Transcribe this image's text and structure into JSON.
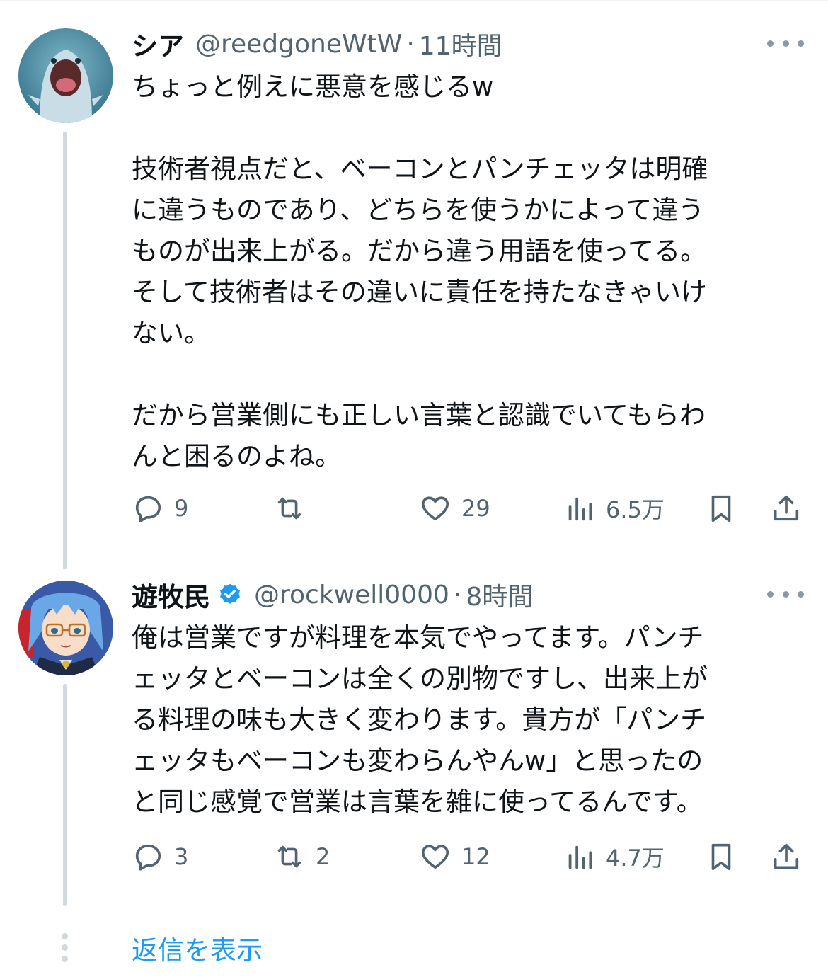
{
  "tweets": [
    {
      "name": "シア",
      "handle": "@reedgoneWtW",
      "separator": "·",
      "time": "11時間",
      "verified": false,
      "avatar_icon": "avatar-quagsire",
      "body_lines": [
        "ちょっと例えに悪意を感じるw",
        "",
        "技術者視点だと、ベーコンとパンチェッタは明確",
        "に違うものであり、どちらを使うかによって違う",
        "ものが出来上がる。だから違う用語を使ってる。",
        "そして技術者はその違いに責任を持たなきゃいけ",
        "ない。",
        "",
        "だから営業側にも正しい言葉と認識でいてもらわ",
        "んと困るのよね。"
      ],
      "stats": {
        "replies": "9",
        "retweets": "",
        "likes": "29",
        "views": "6.5万"
      }
    },
    {
      "name": "遊牧民",
      "handle": "@rockwell0000",
      "separator": "·",
      "time": "8時間",
      "verified": true,
      "avatar_icon": "avatar-anime-girl",
      "body_lines": [
        "俺は営業ですが料理を本気でやってます。パンチ",
        "ェッタとベーコンは全くの別物ですし、出来上が",
        "る料理の味も大きく変わります。貴方が「パンチ",
        "ェッタもベーコンも変わらんやんw」と思ったの",
        "と同じ感覚で営業は言葉を雑に使ってるんです。"
      ],
      "stats": {
        "replies": "3",
        "retweets": "2",
        "likes": "12",
        "views": "4.7万"
      }
    }
  ],
  "show_replies_label": "返信を表示",
  "icons": {
    "reply": "reply-icon",
    "retweet": "retweet-icon",
    "like": "heart-icon",
    "views": "bar-chart-icon",
    "bookmark": "bookmark-icon",
    "share": "share-icon",
    "more": "more-icon",
    "verified": "verified-badge-icon"
  },
  "colors": {
    "text": "#0f1419",
    "secondary": "#536471",
    "link": "#1d9bf0",
    "verified": "#1d9bf0",
    "thread_line": "#cfd9de"
  }
}
